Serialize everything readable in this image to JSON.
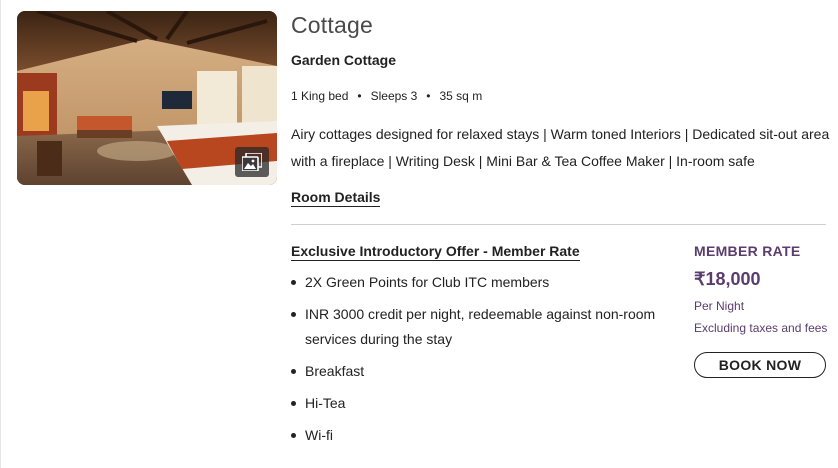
{
  "room": {
    "title": "Cottage",
    "subtitle": "Garden Cottage",
    "specs": [
      "1 King bed",
      "Sleeps 3",
      "35 sq m"
    ],
    "description": "Airy cottages designed for relaxed stays | Warm toned Interiors | Dedicated sit-out area with a fireplace | Writing Desk | Mini Bar & Tea Coffee Maker | In-room safe",
    "details_link": "Room Details",
    "gallery_icon": "image-gallery-icon"
  },
  "offer": {
    "title": "Exclusive Introductory Offer - Member Rate",
    "benefits": [
      "2X Green Points for Club ITC members",
      "INR 3000 credit per night, redeemable against non-room services during the stay",
      "Breakfast",
      "Hi-Tea",
      "Wi-fi"
    ]
  },
  "rate": {
    "label": "MEMBER RATE",
    "price": "₹18,000",
    "per": "Per Night",
    "note": "Excluding taxes and fees",
    "book_label": "BOOK NOW"
  },
  "colors": {
    "accent": "#5b3c6e",
    "text": "#222222",
    "divider": "#cfcfcf"
  }
}
